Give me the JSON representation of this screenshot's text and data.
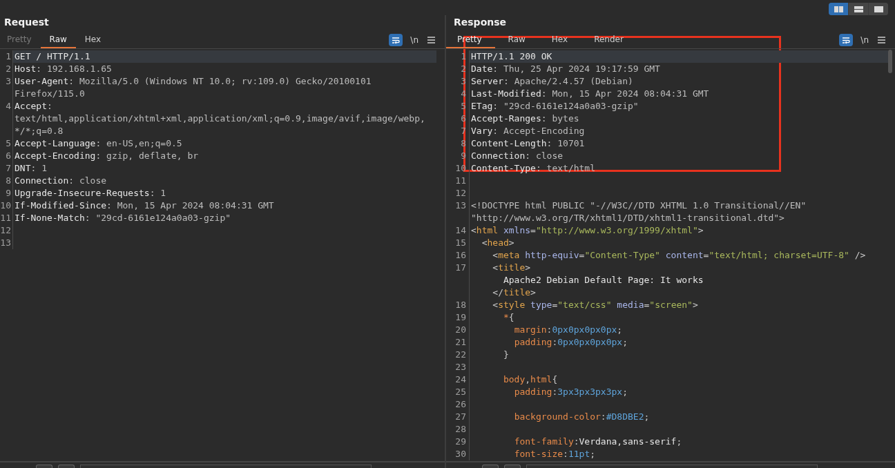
{
  "view_toggles": [
    {
      "selected": true
    },
    {
      "selected": false
    },
    {
      "selected": false
    }
  ],
  "request": {
    "title": "Request",
    "tabs": [
      {
        "label": "Pretty",
        "selected": false,
        "disabled": true
      },
      {
        "label": "Raw",
        "selected": true,
        "disabled": false
      },
      {
        "label": "Hex",
        "selected": false,
        "disabled": false
      }
    ],
    "wrap_on": true,
    "newline_label": "\\n",
    "lines": [
      {
        "number": "1",
        "selected": true,
        "rows": [
          [
            {
              "kind": "text",
              "text": "GET / HTTP/1.1"
            }
          ]
        ]
      },
      {
        "number": "2",
        "selected": false,
        "rows": [
          [
            {
              "kind": "name",
              "text": "Host"
            },
            {
              "kind": "punct",
              "text": ": "
            },
            {
              "kind": "value",
              "text": "192.168.1.65"
            }
          ]
        ]
      },
      {
        "number": "3",
        "selected": false,
        "rows": [
          [
            {
              "kind": "name",
              "text": "User-Agent"
            },
            {
              "kind": "punct",
              "text": ": "
            },
            {
              "kind": "value",
              "text": "Mozilla/5.0 (Windows NT 10.0; rv:109.0) Gecko/20100101"
            }
          ],
          [
            {
              "kind": "value",
              "text": "Firefox/115.0"
            }
          ]
        ]
      },
      {
        "number": "4",
        "selected": false,
        "rows": [
          [
            {
              "kind": "name",
              "text": "Accept"
            },
            {
              "kind": "punct",
              "text": ":"
            }
          ],
          [
            {
              "kind": "value",
              "text": "text/html,application/xhtml+xml,application/xml;q=0.9,image/avif,image/webp,"
            }
          ],
          [
            {
              "kind": "value",
              "text": "*/*;q=0.8"
            }
          ]
        ]
      },
      {
        "number": "5",
        "selected": false,
        "rows": [
          [
            {
              "kind": "name",
              "text": "Accept-Language"
            },
            {
              "kind": "punct",
              "text": ": "
            },
            {
              "kind": "value",
              "text": "en-US,en;q=0.5"
            }
          ]
        ]
      },
      {
        "number": "6",
        "selected": false,
        "rows": [
          [
            {
              "kind": "name",
              "text": "Accept-Encoding"
            },
            {
              "kind": "punct",
              "text": ": "
            },
            {
              "kind": "value",
              "text": "gzip, deflate, br"
            }
          ]
        ]
      },
      {
        "number": "7",
        "selected": false,
        "rows": [
          [
            {
              "kind": "name",
              "text": "DNT"
            },
            {
              "kind": "punct",
              "text": ": "
            },
            {
              "kind": "value",
              "text": "1"
            }
          ]
        ]
      },
      {
        "number": "8",
        "selected": false,
        "rows": [
          [
            {
              "kind": "name",
              "text": "Connection"
            },
            {
              "kind": "punct",
              "text": ": "
            },
            {
              "kind": "value",
              "text": "close"
            }
          ]
        ]
      },
      {
        "number": "9",
        "selected": false,
        "rows": [
          [
            {
              "kind": "name",
              "text": "Upgrade-Insecure-Requests"
            },
            {
              "kind": "punct",
              "text": ": "
            },
            {
              "kind": "value",
              "text": "1"
            }
          ]
        ]
      },
      {
        "number": "10",
        "selected": false,
        "rows": [
          [
            {
              "kind": "name",
              "text": "If-Modified-Since"
            },
            {
              "kind": "punct",
              "text": ": "
            },
            {
              "kind": "value",
              "text": "Mon, 15 Apr 2024 08:04:31 GMT"
            }
          ]
        ]
      },
      {
        "number": "11",
        "selected": false,
        "rows": [
          [
            {
              "kind": "name",
              "text": "If-None-Match"
            },
            {
              "kind": "punct",
              "text": ": "
            },
            {
              "kind": "value",
              "text": "\"29cd-6161e124a0a03-gzip\""
            }
          ]
        ]
      },
      {
        "number": "12",
        "selected": false
      },
      {
        "number": "13",
        "selected": false
      }
    ]
  },
  "response": {
    "title": "Response",
    "tabs": [
      {
        "label": "Pretty",
        "selected": true,
        "disabled": false
      },
      {
        "label": "Raw",
        "selected": false,
        "disabled": false
      },
      {
        "label": "Hex",
        "selected": false,
        "disabled": false
      },
      {
        "label": "Render",
        "selected": false,
        "disabled": false
      }
    ],
    "wrap_on": true,
    "newline_label": "\\n",
    "lines": [
      {
        "number": "1",
        "selected": true,
        "rows": [
          [
            {
              "kind": "text",
              "text": "HTTP/1.1 200 OK"
            }
          ]
        ]
      },
      {
        "number": "2",
        "selected": false,
        "rows": [
          [
            {
              "kind": "name",
              "text": "Date"
            },
            {
              "kind": "punct",
              "text": ": "
            },
            {
              "kind": "value",
              "text": "Thu, 25 Apr 2024 19:17:59 GMT"
            }
          ]
        ]
      },
      {
        "number": "3",
        "selected": false,
        "rows": [
          [
            {
              "kind": "name",
              "text": "Server"
            },
            {
              "kind": "punct",
              "text": ": "
            },
            {
              "kind": "value",
              "text": "Apache/2.4.57 (Debian)"
            }
          ]
        ]
      },
      {
        "number": "4",
        "selected": false,
        "rows": [
          [
            {
              "kind": "name",
              "text": "Last-Modified"
            },
            {
              "kind": "punct",
              "text": ": "
            },
            {
              "kind": "value",
              "text": "Mon, 15 Apr 2024 08:04:31 GMT"
            }
          ]
        ]
      },
      {
        "number": "5",
        "selected": false,
        "rows": [
          [
            {
              "kind": "name",
              "text": "ETag"
            },
            {
              "kind": "punct",
              "text": ": "
            },
            {
              "kind": "value",
              "text": "\"29cd-6161e124a0a03-gzip\""
            }
          ]
        ]
      },
      {
        "number": "6",
        "selected": false,
        "rows": [
          [
            {
              "kind": "name",
              "text": "Accept-Ranges"
            },
            {
              "kind": "punct",
              "text": ": "
            },
            {
              "kind": "value",
              "text": "bytes"
            }
          ]
        ]
      },
      {
        "number": "7",
        "selected": false,
        "rows": [
          [
            {
              "kind": "name",
              "text": "Vary"
            },
            {
              "kind": "punct",
              "text": ": "
            },
            {
              "kind": "value",
              "text": "Accept-Encoding"
            }
          ]
        ]
      },
      {
        "number": "8",
        "selected": false,
        "rows": [
          [
            {
              "kind": "name",
              "text": "Content-Length"
            },
            {
              "kind": "punct",
              "text": ": "
            },
            {
              "kind": "value",
              "text": "10701"
            }
          ]
        ]
      },
      {
        "number": "9",
        "selected": false,
        "rows": [
          [
            {
              "kind": "name",
              "text": "Connection"
            },
            {
              "kind": "punct",
              "text": ": "
            },
            {
              "kind": "value",
              "text": "close"
            }
          ]
        ]
      },
      {
        "number": "10",
        "selected": false,
        "rows": [
          [
            {
              "kind": "name",
              "text": "Content-Type"
            },
            {
              "kind": "punct",
              "text": ": "
            },
            {
              "kind": "value",
              "text": "text/html"
            }
          ]
        ]
      },
      {
        "number": "11",
        "selected": false
      },
      {
        "number": "12",
        "selected": false
      },
      {
        "number": "13",
        "selected": false,
        "rows": [
          [
            {
              "kind": "doctype",
              "text": "<!DOCTYPE html PUBLIC \"-//W3C//DTD XHTML 1.0 Transitional//EN\""
            }
          ],
          [
            {
              "kind": "doctype",
              "text": "\"http://www.w3.org/TR/xhtml1/DTD/xhtml1-transitional.dtd\">"
            }
          ]
        ]
      },
      {
        "number": "14",
        "selected": false,
        "rows": [
          [
            {
              "kind": "punct",
              "text": "<"
            },
            {
              "kind": "tag",
              "text": "html"
            },
            {
              "kind": "attr",
              "text": " xmlns"
            },
            {
              "kind": "punct",
              "text": "="
            },
            {
              "kind": "string",
              "text": "\"http://www.w3.org/1999/xhtml\""
            },
            {
              "kind": "punct",
              "text": ">"
            }
          ]
        ]
      },
      {
        "number": "15",
        "selected": false,
        "rows": [
          [
            {
              "kind": "punct",
              "text": "  <"
            },
            {
              "kind": "tag",
              "text": "head"
            },
            {
              "kind": "punct",
              "text": ">"
            }
          ]
        ]
      },
      {
        "number": "16",
        "selected": false,
        "rows": [
          [
            {
              "kind": "punct",
              "text": "    <"
            },
            {
              "kind": "tag",
              "text": "meta"
            },
            {
              "kind": "attr",
              "text": " http-equiv"
            },
            {
              "kind": "punct",
              "text": "="
            },
            {
              "kind": "string",
              "text": "\"Content-Type\""
            },
            {
              "kind": "attr",
              "text": " content"
            },
            {
              "kind": "punct",
              "text": "="
            },
            {
              "kind": "string",
              "text": "\"text/html; charset=UTF-8\""
            },
            {
              "kind": "punct",
              "text": " />"
            }
          ]
        ]
      },
      {
        "number": "17",
        "selected": false,
        "rows": [
          [
            {
              "kind": "punct",
              "text": "    <"
            },
            {
              "kind": "tag",
              "text": "title"
            },
            {
              "kind": "punct",
              "text": ">"
            }
          ],
          [
            {
              "kind": "punct",
              "text": "      "
            },
            {
              "kind": "text",
              "text": "Apache2 Debian Default Page: It works"
            }
          ],
          [
            {
              "kind": "punct",
              "text": "    </"
            },
            {
              "kind": "tag",
              "text": "title"
            },
            {
              "kind": "punct",
              "text": ">"
            }
          ]
        ]
      },
      {
        "number": "18",
        "selected": false,
        "rows": [
          [
            {
              "kind": "punct",
              "text": "    <"
            },
            {
              "kind": "tag",
              "text": "style"
            },
            {
              "kind": "attr",
              "text": " type"
            },
            {
              "kind": "punct",
              "text": "="
            },
            {
              "kind": "string",
              "text": "\"text/css\""
            },
            {
              "kind": "attr",
              "text": " media"
            },
            {
              "kind": "punct",
              "text": "="
            },
            {
              "kind": "string",
              "text": "\"screen\""
            },
            {
              "kind": "punct",
              "text": ">"
            }
          ]
        ]
      },
      {
        "number": "19",
        "selected": false,
        "rows": [
          [
            {
              "kind": "punct",
              "text": "      "
            },
            {
              "kind": "prop",
              "text": "*"
            },
            {
              "kind": "punct",
              "text": "{"
            }
          ]
        ]
      },
      {
        "number": "20",
        "selected": false,
        "rows": [
          [
            {
              "kind": "punct",
              "text": "        "
            },
            {
              "kind": "prop",
              "text": "margin"
            },
            {
              "kind": "punct",
              "text": ":"
            },
            {
              "kind": "number",
              "text": "0px0px0px0px"
            },
            {
              "kind": "punct",
              "text": ";"
            }
          ]
        ]
      },
      {
        "number": "21",
        "selected": false,
        "rows": [
          [
            {
              "kind": "punct",
              "text": "        "
            },
            {
              "kind": "prop",
              "text": "padding"
            },
            {
              "kind": "punct",
              "text": ":"
            },
            {
              "kind": "number",
              "text": "0px0px0px0px"
            },
            {
              "kind": "punct",
              "text": ";"
            }
          ]
        ]
      },
      {
        "number": "22",
        "selected": false,
        "rows": [
          [
            {
              "kind": "punct",
              "text": "      }"
            }
          ]
        ]
      },
      {
        "number": "23",
        "selected": false
      },
      {
        "number": "24",
        "selected": false,
        "rows": [
          [
            {
              "kind": "punct",
              "text": "      "
            },
            {
              "kind": "prop",
              "text": "body"
            },
            {
              "kind": "punct",
              "text": ","
            },
            {
              "kind": "prop",
              "text": "html"
            },
            {
              "kind": "punct",
              "text": "{"
            }
          ]
        ]
      },
      {
        "number": "25",
        "selected": false,
        "rows": [
          [
            {
              "kind": "punct",
              "text": "        "
            },
            {
              "kind": "prop",
              "text": "padding"
            },
            {
              "kind": "punct",
              "text": ":"
            },
            {
              "kind": "number",
              "text": "3px3px3px3px"
            },
            {
              "kind": "punct",
              "text": ";"
            }
          ]
        ]
      },
      {
        "number": "26",
        "selected": false
      },
      {
        "number": "27",
        "selected": false,
        "rows": [
          [
            {
              "kind": "punct",
              "text": "        "
            },
            {
              "kind": "prop",
              "text": "background-color"
            },
            {
              "kind": "punct",
              "text": ":"
            },
            {
              "kind": "number",
              "text": "#D8DBE2"
            },
            {
              "kind": "punct",
              "text": ";"
            }
          ]
        ]
      },
      {
        "number": "28",
        "selected": false
      },
      {
        "number": "29",
        "selected": false,
        "rows": [
          [
            {
              "kind": "punct",
              "text": "        "
            },
            {
              "kind": "prop",
              "text": "font-family"
            },
            {
              "kind": "punct",
              "text": ":"
            },
            {
              "kind": "name",
              "text": "Verdana,sans-serif"
            },
            {
              "kind": "punct",
              "text": ";"
            }
          ]
        ]
      },
      {
        "number": "30",
        "selected": false,
        "rows": [
          [
            {
              "kind": "punct",
              "text": "        "
            },
            {
              "kind": "prop",
              "text": "font-size"
            },
            {
              "kind": "punct",
              "text": ":"
            },
            {
              "kind": "number",
              "text": "11pt"
            },
            {
              "kind": "punct",
              "text": ";"
            }
          ]
        ]
      }
    ]
  }
}
